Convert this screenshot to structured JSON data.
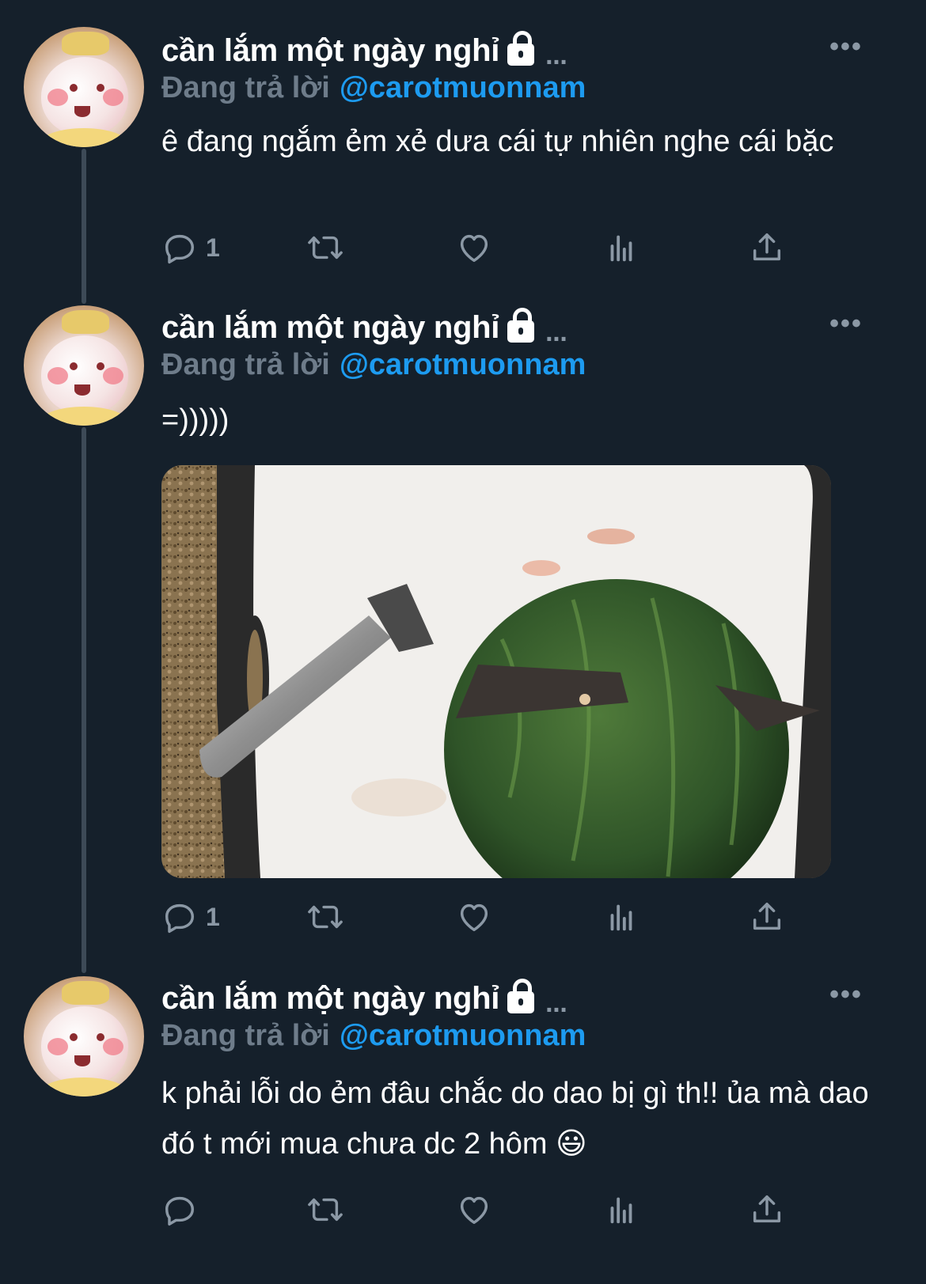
{
  "tweets": [
    {
      "author": "cần lắm một ngày nghỉ",
      "ellipsis": "...",
      "more": "•••",
      "replying_label": "Đang trả lời",
      "replying_handle": "@carotmuonnam",
      "text": "ê đang ngắm ẻm xẻ dưa cái tự nhiên nghe cái bặc",
      "reply_count": "1",
      "has_media": false
    },
    {
      "author": "cần lắm một ngày nghỉ",
      "ellipsis": "...",
      "more": "•••",
      "replying_label": "Đang trả lời",
      "replying_handle": "@carotmuonnam",
      "text": "=)))))",
      "reply_count": "1",
      "has_media": true
    },
    {
      "author": "cần lắm một ngày nghỉ",
      "ellipsis": "...",
      "more": "•••",
      "replying_label": "Đang trả lời",
      "replying_handle": "@carotmuonnam",
      "text": "k phải lỗi do ẻm đâu chắc do dao bị gì th!! ủa mà dao đó t mới mua chưa dc 2 hôm 😃",
      "reply_count": "",
      "has_media": false
    }
  ],
  "icons": {
    "reply": "reply-icon",
    "retweet": "retweet-icon",
    "like": "heart-icon",
    "views": "views-icon",
    "share": "share-icon",
    "lock": "lock-icon"
  },
  "colors": {
    "background": "#15202b",
    "accent": "#1d9bf0",
    "muted": "#8b98a5",
    "thread_line": "#3d4a57"
  }
}
